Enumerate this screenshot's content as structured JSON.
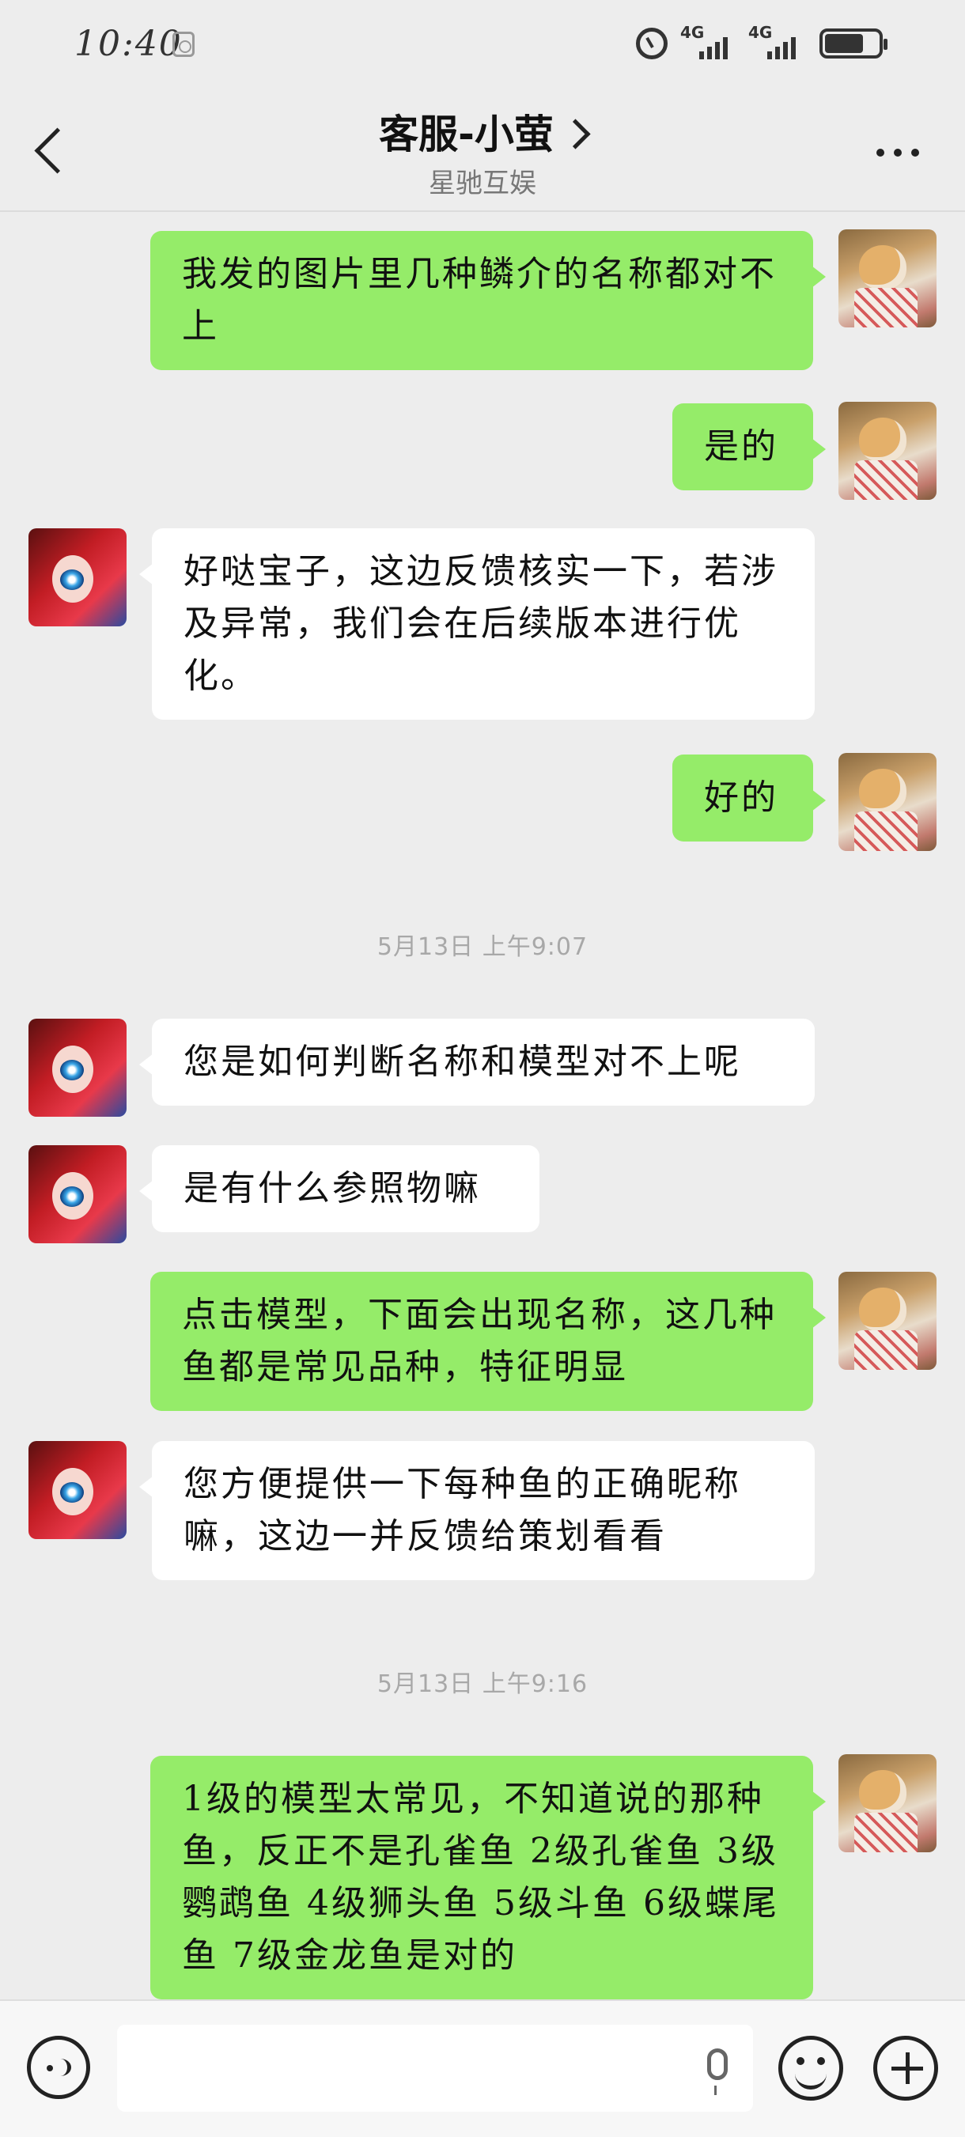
{
  "status_bar": {
    "time": "10:40",
    "signal1": "4G",
    "signal2": "4G"
  },
  "header": {
    "title": "客服-小萤",
    "subtitle": "星驰互娱"
  },
  "messages": [
    {
      "sender": "me",
      "text": "我发的图片里几种鳞介的名称都对不上"
    },
    {
      "sender": "me",
      "text": "是的"
    },
    {
      "sender": "them",
      "text": "好哒宝子，这边反馈核实一下，若涉及异常，我们会在后续版本进行优化。"
    },
    {
      "sender": "me",
      "text": "好的"
    },
    {
      "sender": "them",
      "text": "您是如何判断名称和模型对不上呢"
    },
    {
      "sender": "them",
      "text": "是有什么参照物嘛"
    },
    {
      "sender": "me",
      "text": "点击模型，下面会出现名称，这几种鱼都是常见品种，特征明显"
    },
    {
      "sender": "them",
      "text": "您方便提供一下每种鱼的正确昵称嘛，这边一并反馈给策划看看"
    },
    {
      "sender": "me",
      "text": "1级的模型太常见，不知道说的那种鱼，反正不是孔雀鱼 2级孔雀鱼 3级鹦鹉鱼 4级狮头鱼 5级斗鱼 6级蝶尾鱼 7级金龙鱼是对的"
    }
  ],
  "timestamps": [
    "5月13日 上午9:07",
    "5月13日 上午9:16"
  ],
  "input": {
    "value": ""
  }
}
